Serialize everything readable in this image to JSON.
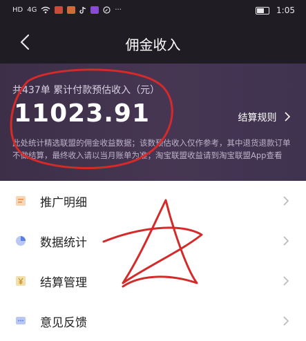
{
  "status_bar": {
    "network_label": "HD",
    "signal_label": "4G",
    "more_label": "···",
    "time": "1:05"
  },
  "nav": {
    "title": "佣金收入"
  },
  "summary": {
    "order_info": "共437单 累计付款预估收入（元）",
    "amount": "11023.91",
    "rule_link": "结算规则",
    "note": "此处统计精选联盟的佣金收益数据；该数预估收入仅作参考，其中退货退款订单不做结算，最终收入请以当月账单为准；淘宝联盟收益请到淘宝联盟App查看"
  },
  "menu": [
    {
      "label": "推广明细",
      "icon": "list-icon",
      "color": "#f0a35a"
    },
    {
      "label": "数据统计",
      "icon": "pie-chart-icon",
      "color": "#5b7ee5"
    },
    {
      "label": "结算管理",
      "icon": "yuan-icon",
      "color": "#d9a53e"
    },
    {
      "label": "意见反馈",
      "icon": "chat-icon",
      "color": "#5b7ee5"
    }
  ]
}
